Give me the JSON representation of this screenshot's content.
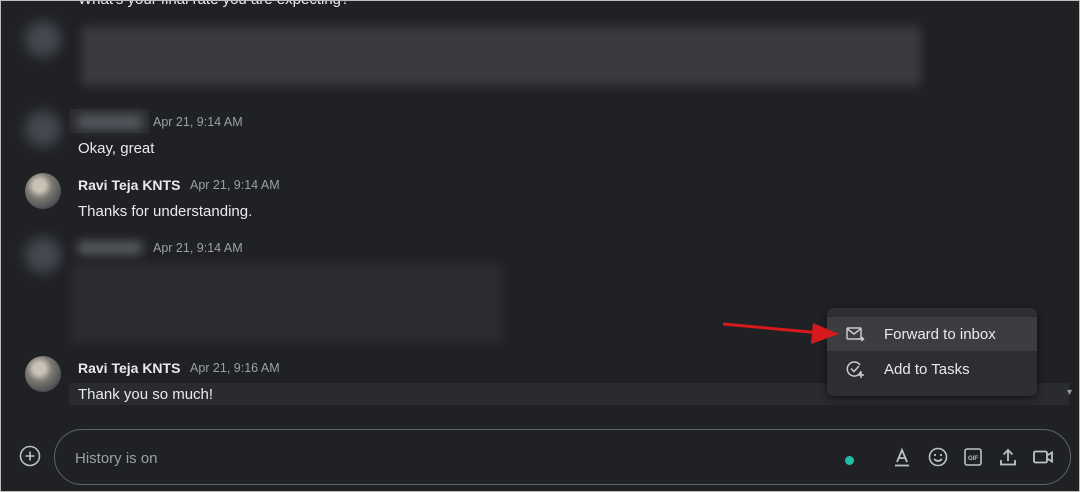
{
  "messages": [
    {
      "text": "What's your final rate you are expecting?"
    },
    {
      "sender": "",
      "time": "Apr 21, 9:14 AM",
      "text": "Okay, great"
    },
    {
      "sender": "Ravi Teja KNTS",
      "time": "Apr 21, 9:14 AM",
      "text": "Thanks for understanding."
    },
    {
      "sender": "",
      "time": "Apr 21, 9:14 AM"
    },
    {
      "sender": "Ravi Teja KNTS",
      "time": "Apr 21, 9:16 AM",
      "text": "Thank you so much!"
    }
  ],
  "context_menu": {
    "items": [
      {
        "label": "Forward to inbox",
        "icon": "forward-mail-icon"
      },
      {
        "label": "Add to Tasks",
        "icon": "add-task-icon"
      }
    ]
  },
  "compose": {
    "placeholder": "History is on",
    "status_color": "#1fbfa5",
    "tools": [
      "format-text-icon",
      "emoji-icon",
      "gif-icon",
      "upload-icon",
      "video-meet-icon"
    ]
  },
  "colors": {
    "background": "#202124",
    "menu": "#2d2e31",
    "annotation_arrow": "#d5191c"
  }
}
